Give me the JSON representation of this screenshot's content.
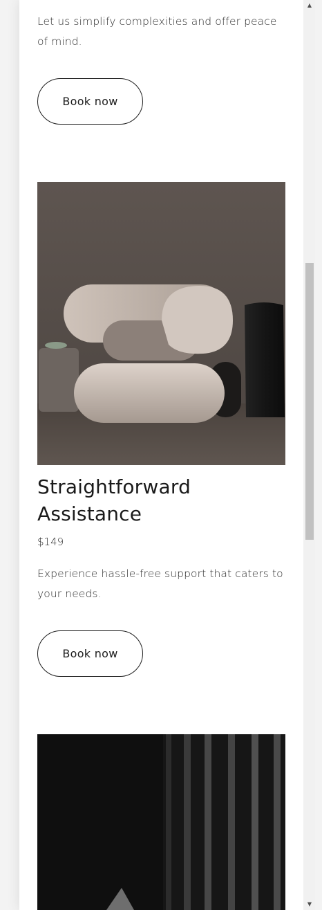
{
  "services": [
    {
      "description": "Let us simplify complexities and offer peace of mind.",
      "button_label": "Book now"
    },
    {
      "image_alt": "sculptural curved armchair",
      "title": "Straightforward Assistance",
      "price": "$149",
      "description": "Experience hassle-free support that caters to your needs.",
      "button_label": "Book now"
    },
    {
      "image_alt": "dark vertical slats"
    }
  ],
  "scrollbar": {
    "up_icon": "arrow-up-icon",
    "down_icon": "arrow-down-icon"
  },
  "colors": {
    "text": "#1a1a1a",
    "page_bg": "#ffffff",
    "outer_bg": "#f3f3f3"
  }
}
